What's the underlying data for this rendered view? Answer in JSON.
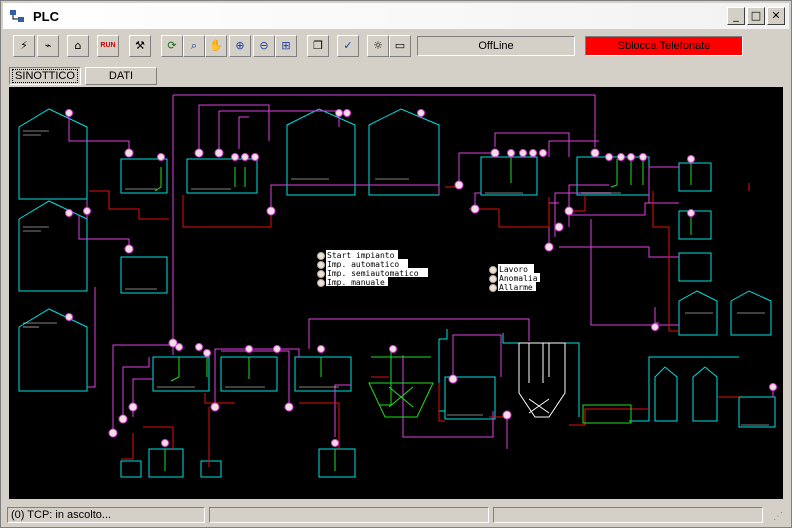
{
  "window": {
    "title": "PLC"
  },
  "toolbar": {
    "offline_label": "OffLine",
    "unlock_label": "Sblocca Telefonate",
    "run_label": "RUN",
    "unlock_color": "#ff0000"
  },
  "tabs": [
    {
      "label": "SINOTTICO",
      "active": true
    },
    {
      "label": "DATI",
      "active": false
    }
  ],
  "legend": {
    "modes": [
      "Start impianto",
      "Imp. automatico",
      "Imp. semiautomatico",
      "Imp. manuale"
    ],
    "states": [
      "Lavoro",
      "Anomalia",
      "Allarme"
    ]
  },
  "statusbar": {
    "message": "(0)  TCP: in ascolto..."
  },
  "colors": {
    "canvas": "#000000",
    "tank": "#00e0e0",
    "pipe_magenta": "#e040e0",
    "pipe_red": "#e01010",
    "pump_green": "#20e020"
  }
}
